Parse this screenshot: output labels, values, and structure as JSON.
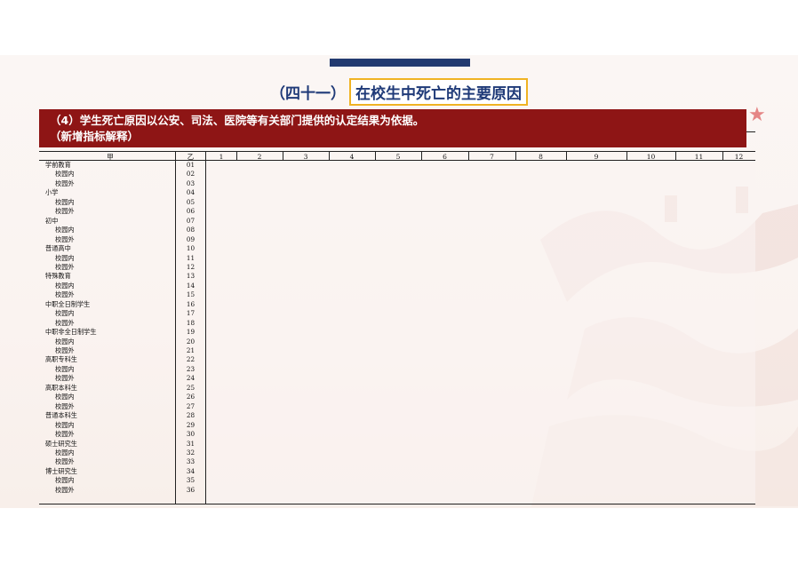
{
  "title": {
    "prefix": "（四十一）",
    "main": "在校生中死亡的主要原因"
  },
  "banner": {
    "line1": "（4）学生死亡原因以公安、司法、医院等有关部门提供的认定结果为依据。",
    "line2": "（新增指标解释）"
  },
  "table": {
    "label_header": "甲",
    "code_header": "乙",
    "column_numbers": [
      "1",
      "2",
      "3",
      "4",
      "5",
      "6",
      "7",
      "8",
      "9",
      "10",
      "11",
      "12"
    ],
    "rows": [
      {
        "label": "学前教育",
        "code": "01",
        "indent": false
      },
      {
        "label": "校园内",
        "code": "02",
        "indent": true
      },
      {
        "label": "校园外",
        "code": "03",
        "indent": true
      },
      {
        "label": "小学",
        "code": "04",
        "indent": false
      },
      {
        "label": "校园内",
        "code": "05",
        "indent": true
      },
      {
        "label": "校园外",
        "code": "06",
        "indent": true
      },
      {
        "label": "初中",
        "code": "07",
        "indent": false
      },
      {
        "label": "校园内",
        "code": "08",
        "indent": true
      },
      {
        "label": "校园外",
        "code": "09",
        "indent": true
      },
      {
        "label": "普通高中",
        "code": "10",
        "indent": false
      },
      {
        "label": "校园内",
        "code": "11",
        "indent": true
      },
      {
        "label": "校园外",
        "code": "12",
        "indent": true
      },
      {
        "label": "特殊教育",
        "code": "13",
        "indent": false
      },
      {
        "label": "校园内",
        "code": "14",
        "indent": true
      },
      {
        "label": "校园外",
        "code": "15",
        "indent": true
      },
      {
        "label": "中职全日制学生",
        "code": "16",
        "indent": false
      },
      {
        "label": "校园内",
        "code": "17",
        "indent": true
      },
      {
        "label": "校园外",
        "code": "18",
        "indent": true
      },
      {
        "label": "中职非全日制学生",
        "code": "19",
        "indent": false
      },
      {
        "label": "校园内",
        "code": "20",
        "indent": true
      },
      {
        "label": "校园外",
        "code": "21",
        "indent": true
      },
      {
        "label": "高职专科生",
        "code": "22",
        "indent": false
      },
      {
        "label": "校园内",
        "code": "23",
        "indent": true
      },
      {
        "label": "校园外",
        "code": "24",
        "indent": true
      },
      {
        "label": "高职本科生",
        "code": "25",
        "indent": false
      },
      {
        "label": "校园内",
        "code": "26",
        "indent": true
      },
      {
        "label": "校园外",
        "code": "27",
        "indent": true
      },
      {
        "label": "普通本科生",
        "code": "28",
        "indent": false
      },
      {
        "label": "校园内",
        "code": "29",
        "indent": true
      },
      {
        "label": "校园外",
        "code": "30",
        "indent": true
      },
      {
        "label": "硕士研究生",
        "code": "31",
        "indent": false
      },
      {
        "label": "校园内",
        "code": "32",
        "indent": true
      },
      {
        "label": "校园外",
        "code": "33",
        "indent": true
      },
      {
        "label": "博士研究生",
        "code": "34",
        "indent": false
      },
      {
        "label": "校园内",
        "code": "35",
        "indent": true
      },
      {
        "label": "校园外",
        "code": "36",
        "indent": true
      }
    ]
  },
  "colors": {
    "title": "#1f3a78",
    "title_border": "#f0b323",
    "banner_bg": "#8e1515",
    "top_bar": "#223a70"
  }
}
